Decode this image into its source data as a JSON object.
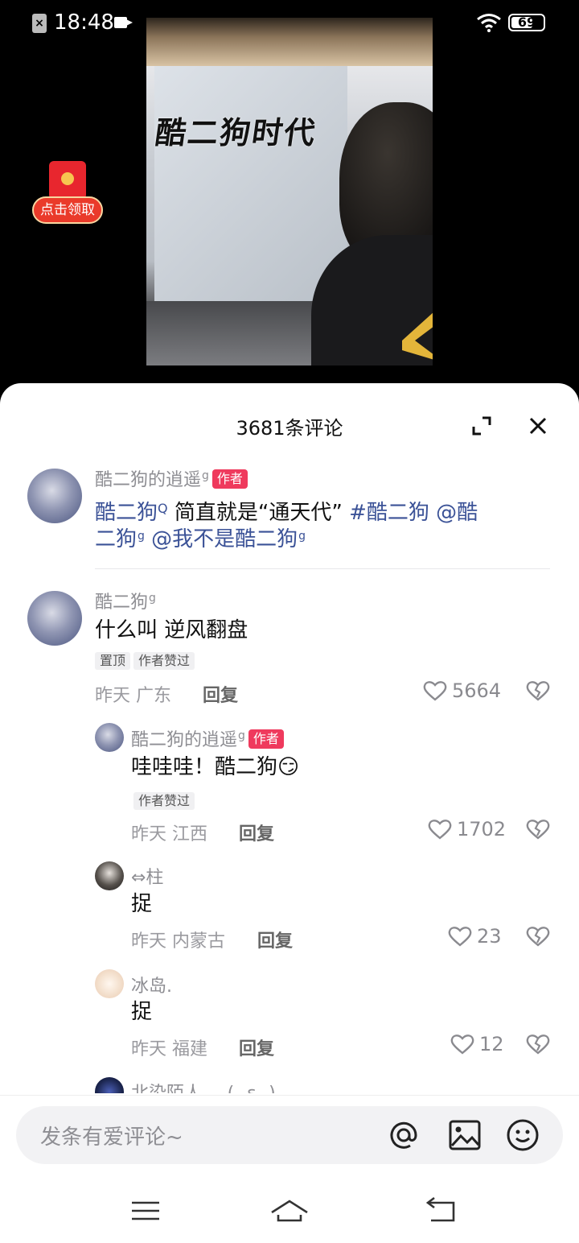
{
  "status_bar": {
    "time": "18:48",
    "battery": "69",
    "battery_level_pct": 69
  },
  "video": {
    "overlay_title": "酷二狗时代"
  },
  "red_packet": {
    "label": "点击领取"
  },
  "comments_sheet": {
    "title": "3681条评论",
    "post": {
      "author": "酷二狗的逍遥",
      "author_badge": "作者",
      "line1_mention": "酷二狗",
      "line1_text": " 简直就是“通天代” ",
      "line1_hashtag": "#酷二狗",
      "line1_at": " @酷",
      "line2_at": "二狗",
      "line2_at2": " @我不是酷二狗"
    },
    "comments": [
      {
        "author": "酷二狗",
        "text": "什么叫 逆风翻盘",
        "tags": [
          "置顶",
          "作者赞过"
        ],
        "time": "昨天",
        "location": "广东",
        "reply_label": "回复",
        "likes": "5664"
      },
      {
        "author": "酷二狗的逍遥",
        "author_badge": "作者",
        "text": "哇哇哇！酷二狗",
        "emoji": "😏",
        "tags": [
          "作者赞过"
        ],
        "time": "昨天",
        "location": "江西",
        "reply_label": "回复",
        "likes": "1702"
      },
      {
        "author": "⇔柱",
        "text": "捉",
        "time": "昨天",
        "location": "内蒙古",
        "reply_label": "回复",
        "likes": "23"
      },
      {
        "author": "冰岛.",
        "text": "捉",
        "time": "昨天",
        "location": "福建",
        "reply_label": "回复",
        "likes": "12"
      },
      {
        "author": "北染陌人 ‿ (◞ ε ◟) ‿"
      }
    ],
    "input_placeholder": "发条有爱评论~"
  },
  "icons": {
    "expand": "expand-icon",
    "close": "close-icon",
    "like": "heart-outline-icon",
    "dislike": "broken-heart-icon",
    "at": "at-icon",
    "image": "image-icon",
    "emoji": "smiley-icon",
    "menu": "menu-icon",
    "home": "home-icon",
    "back": "back-icon"
  },
  "colors": {
    "author_badge": "#ef3a5d",
    "link": "#3b5297",
    "red_packet": "#e8262e"
  }
}
